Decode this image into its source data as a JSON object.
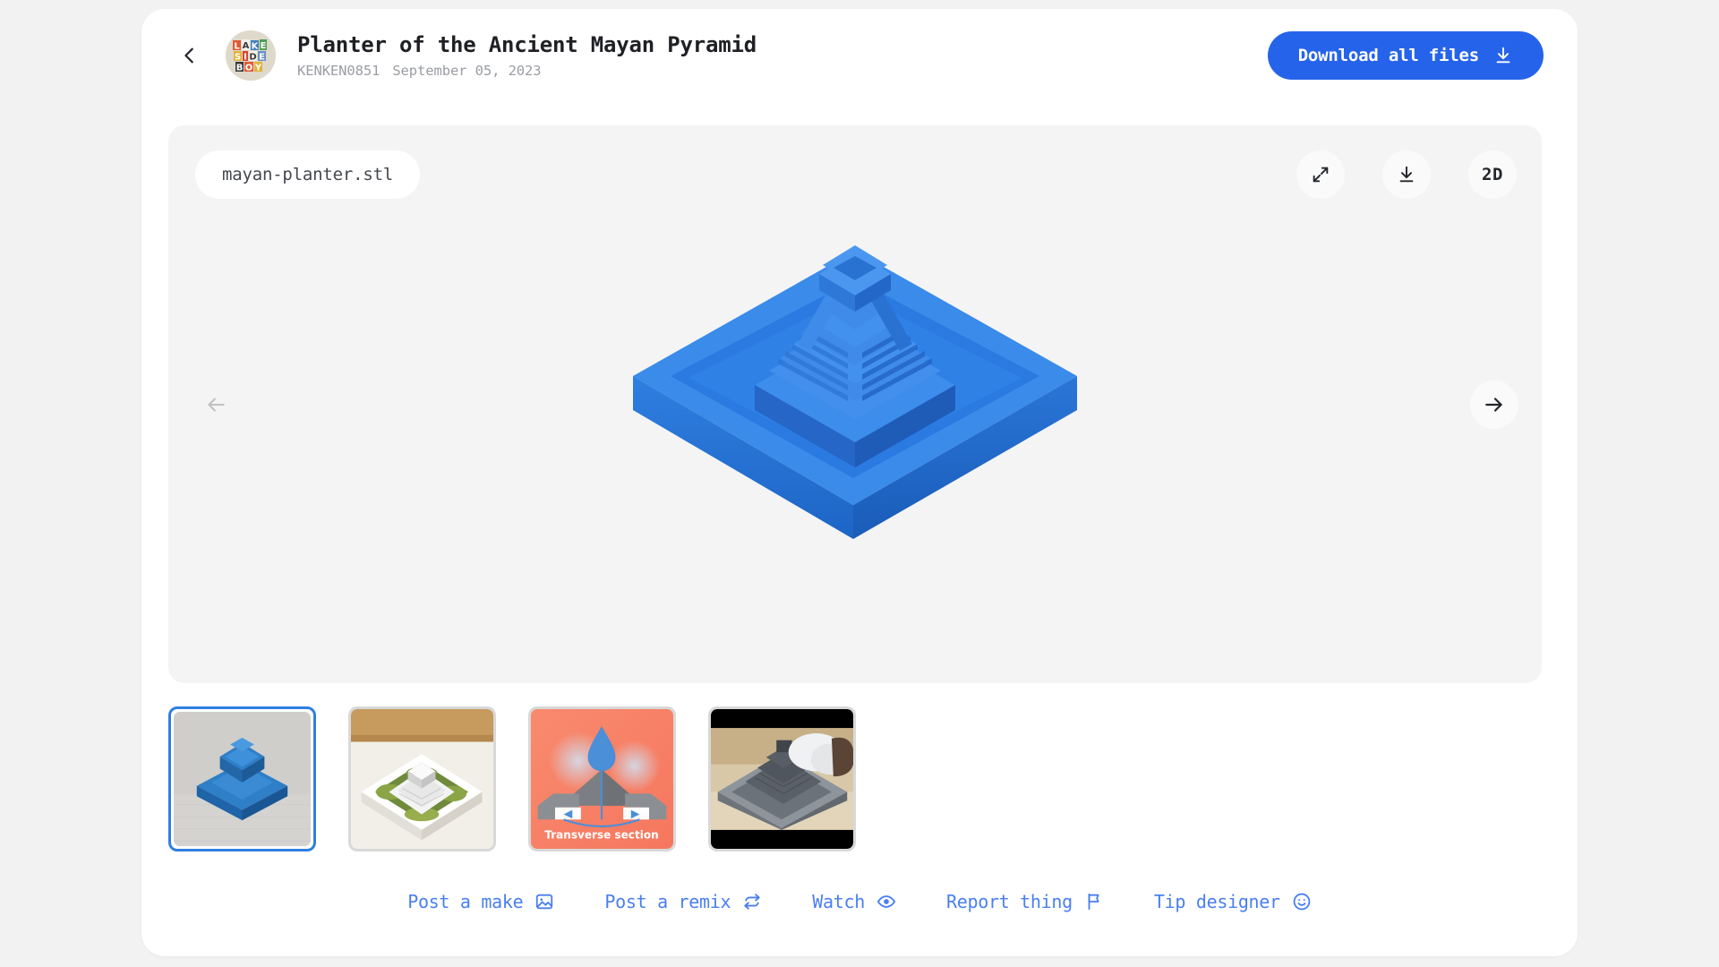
{
  "header": {
    "back_icon": "chevron-left-icon",
    "avatar_alt": "lakesideboy-avatar",
    "title": "Planter of the Ancient Mayan Pyramid",
    "author": "KENKEN0851",
    "date": "September 05, 2023",
    "download_all_label": "Download all files",
    "download_all_icon": "download-icon"
  },
  "viewer": {
    "file_name": "mayan-planter.stl",
    "tools": [
      {
        "name": "fullscreen-button",
        "icon": "expand-arrows-icon",
        "label": ""
      },
      {
        "name": "download-model-button",
        "icon": "download-icon",
        "label": ""
      },
      {
        "name": "toggle-2d-button",
        "icon": "text-label",
        "label": "2D"
      }
    ],
    "prev_label": "←",
    "next_label": "→",
    "prev_enabled": false,
    "next_enabled": true,
    "model_alt": "blue-3d-mayan-pyramid-planter"
  },
  "thumbnails": [
    {
      "name": "thumbnail-1",
      "alt": "blue-3d-render-pyramid-planter",
      "selected": true,
      "caption": ""
    },
    {
      "name": "thumbnail-2",
      "alt": "white-printed-planter-with-moss",
      "selected": false,
      "caption": ""
    },
    {
      "name": "thumbnail-3",
      "alt": "transverse-section-diagram",
      "selected": false,
      "caption": "Transverse section"
    },
    {
      "name": "thumbnail-4",
      "alt": "grey-printed-planter-video",
      "selected": false,
      "caption": ""
    }
  ],
  "actions": [
    {
      "name": "post-a-make-link",
      "label": "Post a make",
      "icon": "image-icon"
    },
    {
      "name": "post-a-remix-link",
      "label": "Post a remix",
      "icon": "refresh-icon"
    },
    {
      "name": "watch-link",
      "label": "Watch",
      "icon": "eye-icon"
    },
    {
      "name": "report-thing-link",
      "label": "Report thing",
      "icon": "flag-icon"
    },
    {
      "name": "tip-designer-link",
      "label": "Tip designer",
      "icon": "smiley-icon"
    }
  ],
  "colors": {
    "page_bg": "#f2f2f3",
    "card_bg": "#ffffff",
    "viewer_bg": "#f4f4f5",
    "accent_blue": "#2563eb",
    "link_blue": "#4a7ff0",
    "model_blue": "#2f7fe0",
    "muted_text": "#9a9da3",
    "title_text": "#1e2024"
  }
}
